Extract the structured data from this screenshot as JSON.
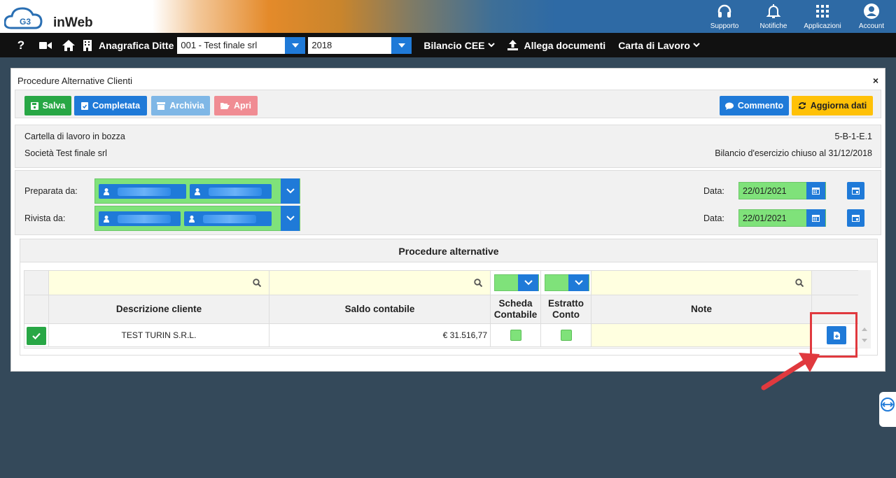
{
  "header": {
    "app_name": "inWeb",
    "logo_letters": "G3",
    "items": [
      {
        "label": "Supporto",
        "icon": "headset-icon"
      },
      {
        "label": "Notifiche",
        "icon": "bell-icon"
      },
      {
        "label": "Applicazioni",
        "icon": "grid-icon"
      },
      {
        "label": "Account",
        "icon": "user-circle-icon"
      }
    ]
  },
  "navbar": {
    "help": "?",
    "anagrafica_label": "Anagrafica Ditte",
    "company_value": "001 - Test finale srl",
    "year_value": "2018",
    "bilancio_label": "Bilancio CEE",
    "allega_label": "Allega documenti",
    "carta_label": "Carta di Lavoro"
  },
  "panel": {
    "title": "Procedure Alternative Clienti",
    "close": "×",
    "buttons": {
      "salva": "Salva",
      "completata": "Completata",
      "archivia": "Archivia",
      "apri": "Apri",
      "commento": "Commento",
      "aggiorna": "Aggiorna dati"
    },
    "info": {
      "status": "Cartella di lavoro in bozza",
      "code": "5-B-1-E.1",
      "company": "Società Test finale srl",
      "bilancio": "Bilancio d'esercizio chiuso al 31/12/2018"
    },
    "preparata": {
      "label": "Preparata da:",
      "date_label": "Data:",
      "date": "22/01/2021"
    },
    "rivista": {
      "label": "Rivista da:",
      "date_label": "Data:",
      "date": "22/01/2021"
    },
    "colors": {
      "blue": "#1f7ad8",
      "green": "#28a745",
      "light_green": "#7fe27a",
      "yellow": "#ffc107",
      "pink": "#f08c93",
      "light_blue": "#7fb7e6"
    }
  },
  "section": {
    "title": "Procedure alternative",
    "columns": [
      "Descrizione cliente",
      "Saldo contabile",
      "Scheda Contabile",
      "Estratto Conto",
      "Note"
    ],
    "rows": [
      {
        "descrizione": "TEST TURIN S.R.L.",
        "saldo": "€ 31.516,77",
        "note": ""
      }
    ]
  }
}
